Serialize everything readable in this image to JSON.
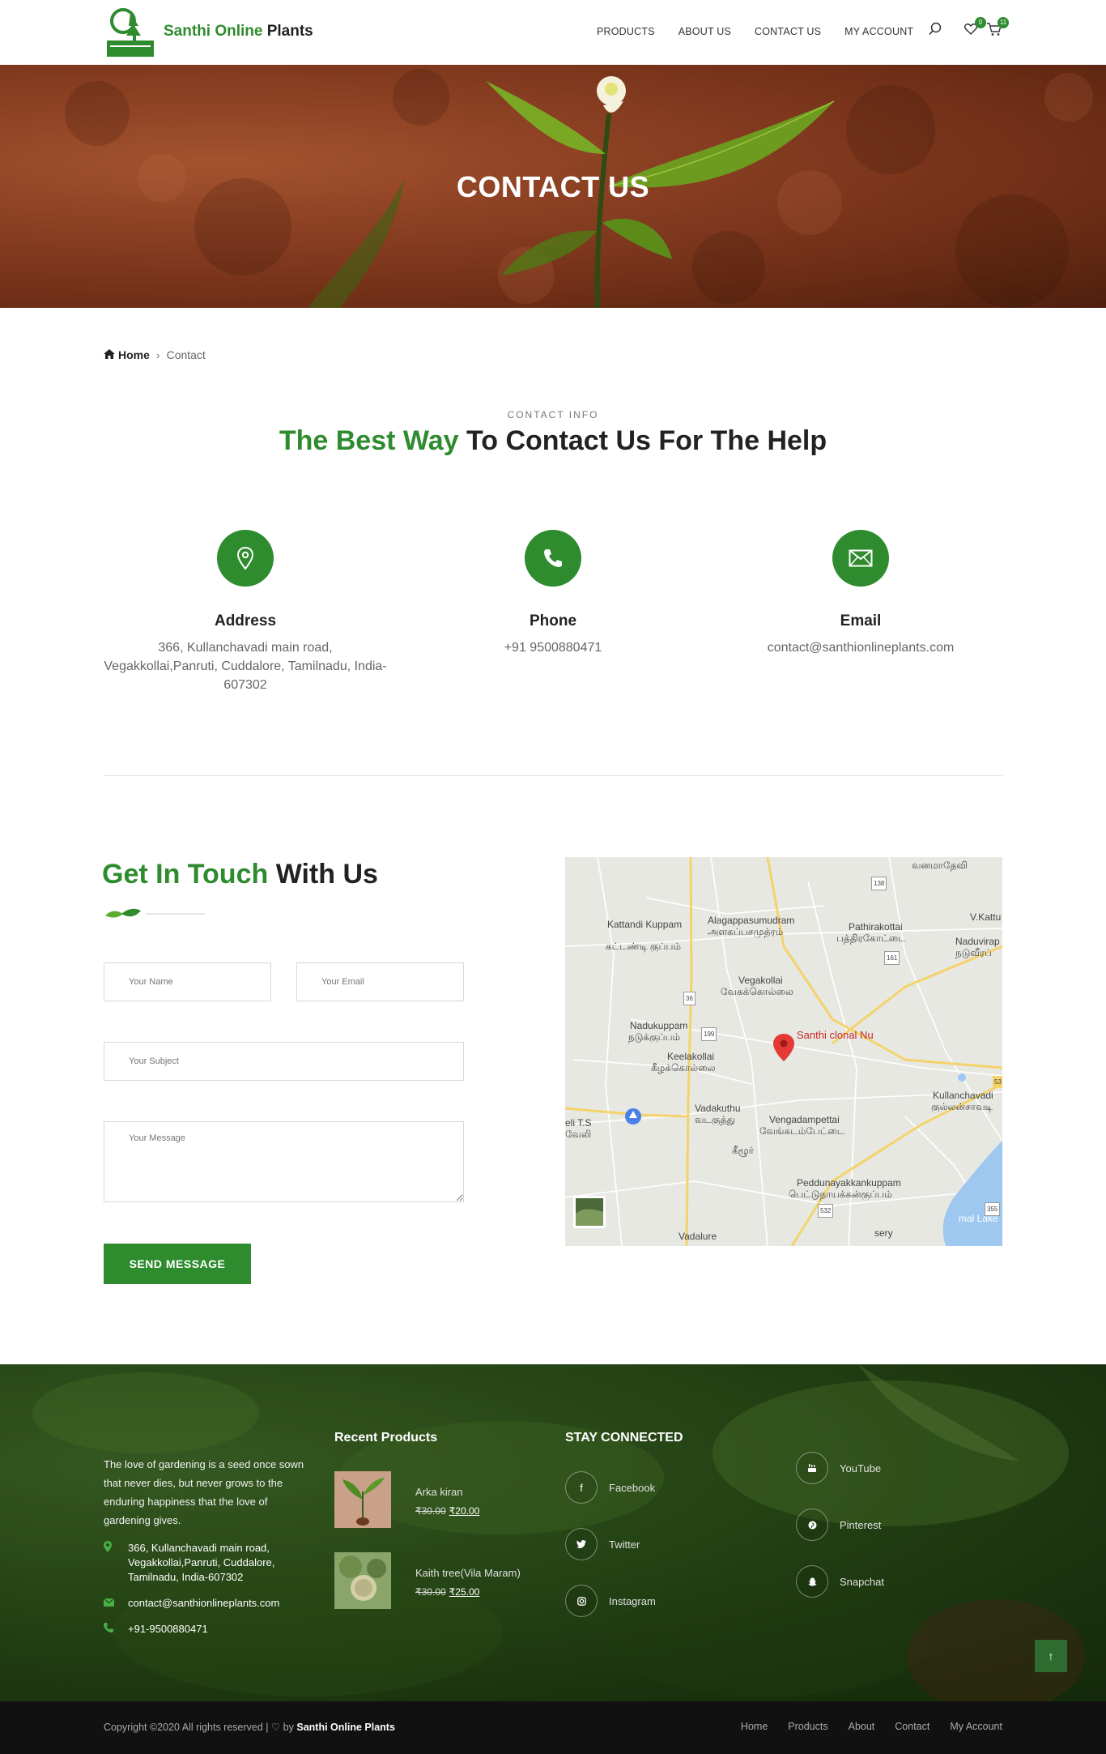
{
  "header": {
    "brand_green": "Santhi Online",
    "brand_dark": "Plants",
    "nav": [
      "PRODUCTS",
      "ABOUT US",
      "CONTACT US",
      "MY ACCOUNT"
    ],
    "wishlist_count": "0",
    "cart_count": "11"
  },
  "hero": {
    "title": "CONTACT US"
  },
  "breadcrumb": {
    "home": "Home",
    "current": "Contact"
  },
  "contact_info": {
    "eyebrow": "CONTACT INFO",
    "heading_green": "The Best Way",
    "heading_dark": " To Contact Us For The Help",
    "items": [
      {
        "title": "Address",
        "text": "366, Kullanchavadi main road, Vegakkollai,Panruti, Cuddalore, Tamilnadu, India-607302",
        "icon": "location-pin-icon"
      },
      {
        "title": "Phone",
        "text": "+91 9500880471",
        "icon": "phone-icon"
      },
      {
        "title": "Email",
        "text": "contact@santhionlineplants.com",
        "icon": "envelope-icon"
      }
    ]
  },
  "form": {
    "heading_green": "Get In Touch",
    "heading_dark": " With Us",
    "name_placeholder": "Your Name",
    "email_placeholder": "Your Email",
    "subject_placeholder": "Your Subject",
    "message_placeholder": "Your Message",
    "submit_label": "SEND MESSAGE"
  },
  "map": {
    "labels": [
      "வனமாதேவி",
      "Alagappasumudram",
      "அளகப்பசமுத்ரம்",
      "Kattandi Kuppam",
      "கட்டண்டி குப்பம்",
      "Pathirakottai",
      "பத்திரகோட்டை",
      "V.Kattu",
      "Naduvirap",
      "நடுவீரப்",
      "Vegakollai",
      "வேகக்கொல்லை",
      "Nadukuppam",
      "நடுக்குப்பம்",
      "Keelakollai",
      "கீழக்கொல்லை",
      "Kullanchavadi",
      "குல்லன்சாவடி",
      "Vadakuthu",
      "வடகுத்து",
      "Vengadampettai",
      "வேங்கடம்பேட்டை",
      "eli T.S",
      "வேலி",
      "கீழூர்",
      "Peddunayakkankuppam",
      "பெட்டுநாயக்கன்குப்பம்",
      "Vadalure",
      "sery",
      "mal Lake",
      "36",
      "138",
      "161",
      "199",
      "532",
      "355",
      "53"
    ],
    "pin_label": "Santhi clonal Nu"
  },
  "footer": {
    "about": "The love of gardening is a seed once sown that never dies, but never grows to the enduring happiness that the love of gardening gives.",
    "address": "366, Kullanchavadi main road, Vegakkollai,Panruti, Cuddalore, Tamilnadu, India-607302",
    "email": "contact@santhionlineplants.com",
    "phone": "+91-9500880471",
    "recent_title": "Recent Products",
    "products": [
      {
        "name": "Arka kiran",
        "old_price": "₹30.00",
        "price": "₹20.00"
      },
      {
        "name": "Kaith tree(Vila Maram)",
        "old_price": "₹30.00",
        "price": "₹25.00"
      }
    ],
    "social_title": "STAY CONNECTED",
    "social": [
      "Facebook",
      "Twitter",
      "Instagram",
      "YouTube",
      "Pinterest",
      "Snapchat"
    ],
    "scroll_top": "↑"
  },
  "bottom": {
    "copyright": "Copyright ©2020 All rights reserved | ♡ by ",
    "copyright_brand": "Santhi Online Plants",
    "links": [
      "Home",
      "Products",
      "About",
      "Contact",
      "My Account"
    ]
  },
  "colors": {
    "accent": "#2e8b2e",
    "footer_bottom": "#111111"
  }
}
